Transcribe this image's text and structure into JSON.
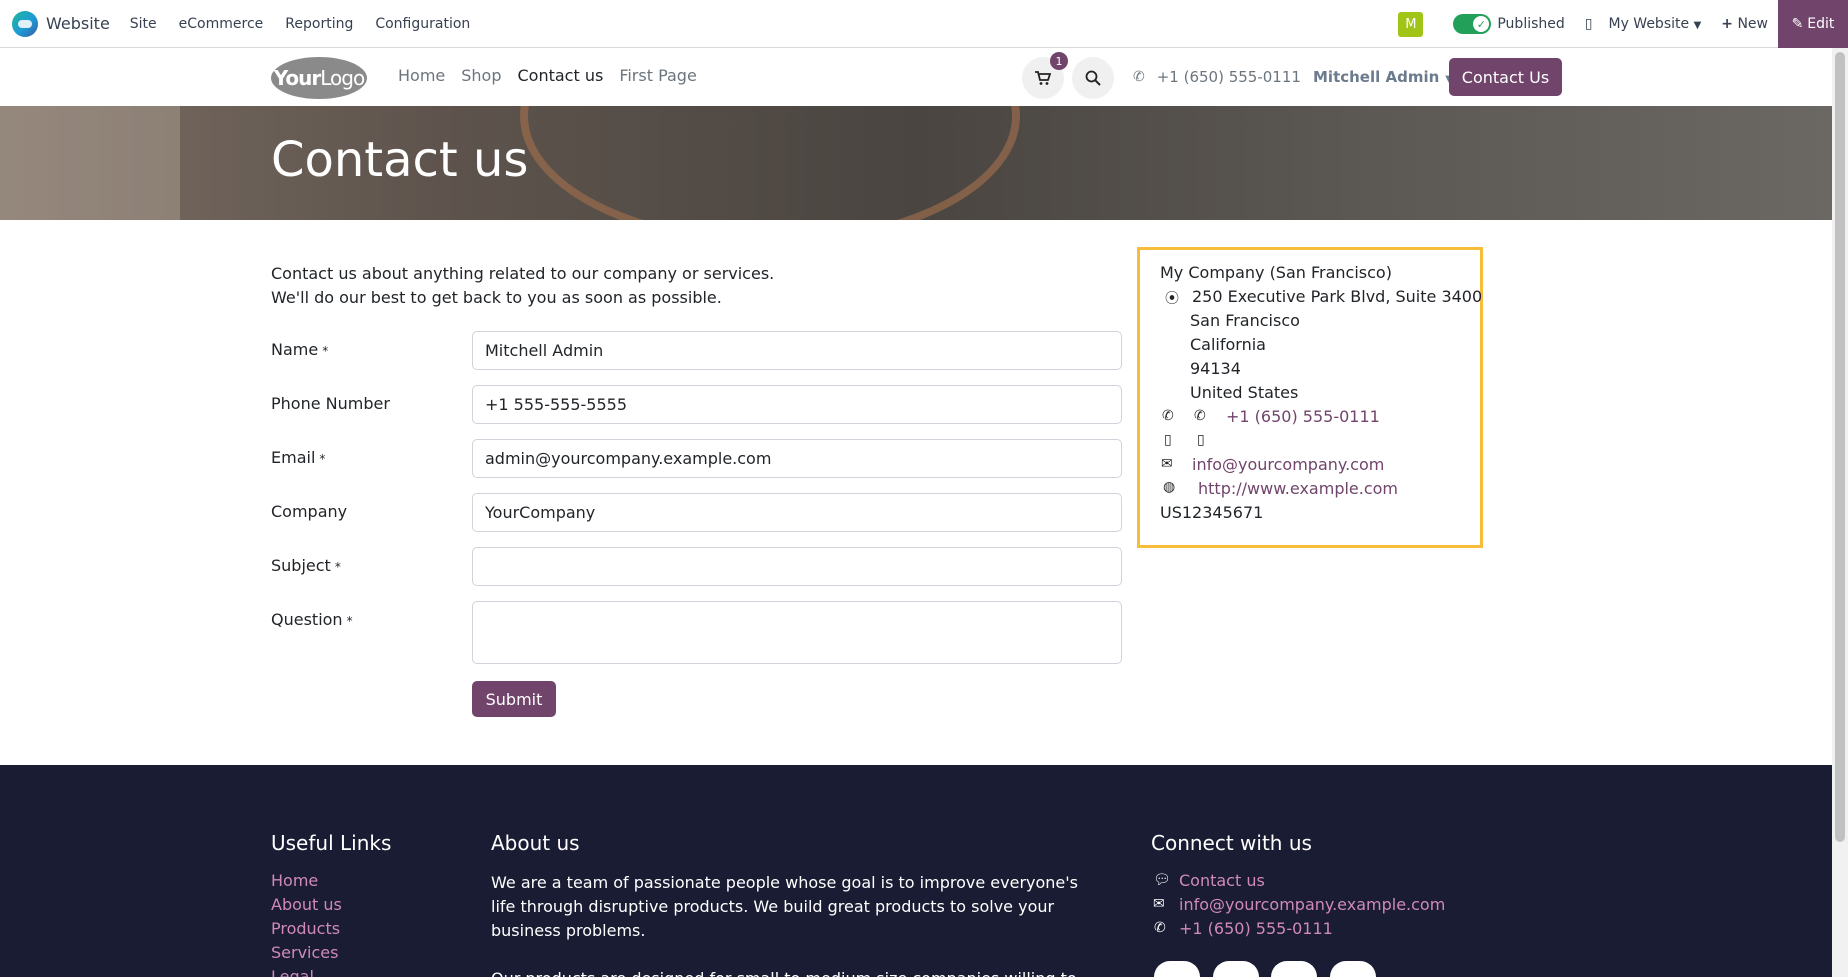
{
  "topbar": {
    "app_name": "Website",
    "menu": [
      "Site",
      "eCommerce",
      "Reporting",
      "Configuration"
    ],
    "avatar_letter": "M",
    "published_label": "Published",
    "my_website_label": "My Website",
    "new_label": "New",
    "edit_label": "Edit",
    "accent": "#71446b"
  },
  "header": {
    "logo_text_1": "Your",
    "logo_text_2": "Logo",
    "nav": [
      "Home",
      "Shop",
      "Contact us",
      "First Page"
    ],
    "active_nav": "Contact us",
    "cart_count": "1",
    "phone": "+1 (650) 555-0111",
    "user": "Mitchell Admin",
    "contact_button": "Contact Us"
  },
  "banner": {
    "title": "Contact us"
  },
  "intro": {
    "line1": "Contact us about anything related to our company or services.",
    "line2": "We'll do our best to get back to you as soon as possible."
  },
  "form": {
    "fields": [
      {
        "label": "Name",
        "required": "*",
        "value": "Mitchell Admin"
      },
      {
        "label": "Phone Number",
        "required": "",
        "value": "+1 555-555-5555"
      },
      {
        "label": "Email",
        "required": "*",
        "value": "admin@yourcompany.example.com"
      },
      {
        "label": "Company",
        "required": "",
        "value": "YourCompany"
      },
      {
        "label": "Subject",
        "required": "*",
        "value": ""
      },
      {
        "label": "Question",
        "required": "*",
        "value": ""
      }
    ],
    "submit_label": "Submit"
  },
  "company": {
    "name": "My Company (San Francisco)",
    "street": "250 Executive Park Blvd, Suite 3400",
    "city": "San Francisco",
    "state": "California",
    "zip": "94134",
    "country": "United States",
    "phone": "+1 (650) 555-0111",
    "email": "info@yourcompany.com",
    "website": "http://www.example.com",
    "vat": "US12345671",
    "border_color": "#f7bd3a"
  },
  "footer": {
    "useful_links_title": "Useful Links",
    "useful_links": [
      "Home",
      "About us",
      "Products",
      "Services",
      "Legal"
    ],
    "about_title": "About us",
    "about_p1_l1": "We are a team of passionate people whose goal is to improve everyone's",
    "about_p1_l2": "life through disruptive products. We build great products to solve your",
    "about_p1_l3": "business problems.",
    "about_p2_l1": "Our products are designed for small to medium size companies willing to",
    "connect_title": "Connect with us",
    "connect_contact": "Contact us",
    "connect_email": "info@yourcompany.example.com",
    "connect_phone": "+1 (650) 555-0111",
    "bg_color": "#191c33",
    "link_color": "#d08ab8"
  }
}
